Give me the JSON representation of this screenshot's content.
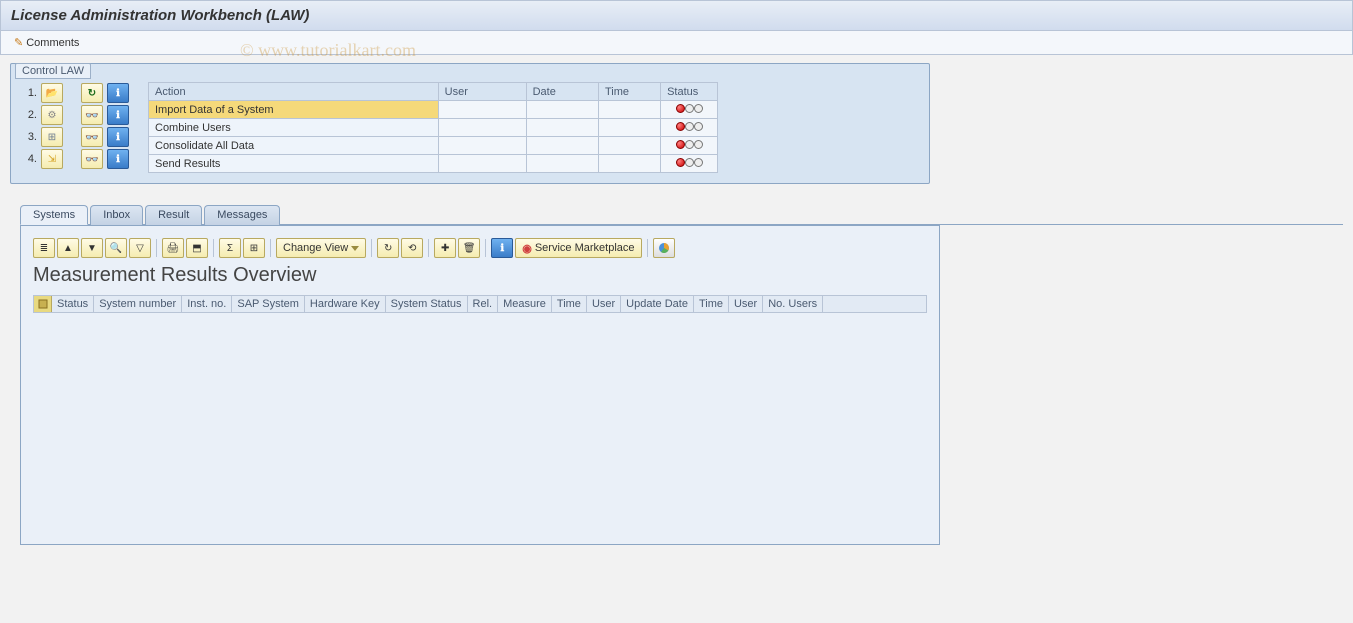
{
  "title": "License Administration Workbench (LAW)",
  "toolbar": {
    "comments_label": "Comments"
  },
  "watermark": "© www.tutorialkart.com",
  "control_box": {
    "title": "Control LAW",
    "columns": {
      "action": "Action",
      "user": "User",
      "date": "Date",
      "time": "Time",
      "status": "Status"
    },
    "rows": [
      {
        "num": "1.",
        "action": "Import Data of a System",
        "user": "",
        "date": "",
        "time": "",
        "selected": true
      },
      {
        "num": "2.",
        "action": "Combine Users",
        "user": "",
        "date": "",
        "time": "",
        "selected": false
      },
      {
        "num": "3.",
        "action": "Consolidate All Data",
        "user": "",
        "date": "",
        "time": "",
        "selected": false
      },
      {
        "num": "4.",
        "action": "Send Results",
        "user": "",
        "date": "",
        "time": "",
        "selected": false
      }
    ]
  },
  "tabs": {
    "items": [
      {
        "label": "Systems",
        "active": true
      },
      {
        "label": "Inbox",
        "active": false
      },
      {
        "label": "Result",
        "active": false
      },
      {
        "label": "Messages",
        "active": false
      }
    ]
  },
  "panel": {
    "change_view_label": "Change View",
    "service_marketplace_label": "Service Marketplace",
    "title": "Measurement Results Overview",
    "columns": [
      "Status",
      "System number",
      "Inst. no.",
      "SAP System",
      "Hardware Key",
      "System Status",
      "Rel.",
      "Measure",
      "Time",
      "User",
      "Update Date",
      "Time",
      "User",
      "No. Users"
    ]
  }
}
